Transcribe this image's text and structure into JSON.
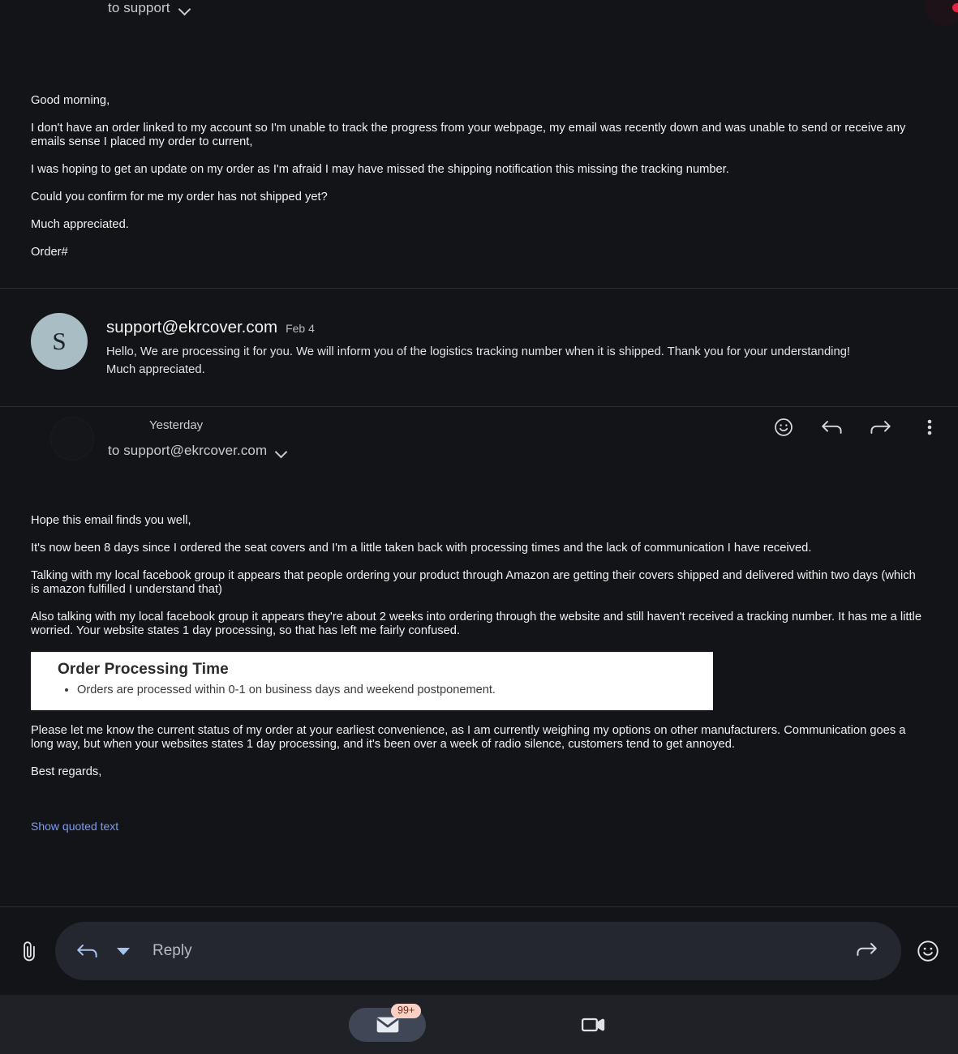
{
  "message1": {
    "to_label": "to support",
    "paragraphs": [
      "Good morning,",
      "I don't have an order linked to my account so I'm unable to track the progress from your webpage, my email was recently down and was unable to send or receive any emails sense I placed my order to current,",
      "I was hoping to get an update on my order as I'm afraid I may have missed the shipping notification this missing the tracking number.",
      "Could you confirm for me my order has not shipped yet?",
      "Much appreciated.",
      "Order#"
    ]
  },
  "message2": {
    "avatar_initial": "S",
    "sender": "support@ekrcover.com",
    "date": "Feb 4",
    "body": "Hello, We are processing it for you. We will inform you of the logistics tracking number when it is shipped. Thank you for your understanding! Much appreciated."
  },
  "message3": {
    "date": "Yesterday",
    "to_label": "to support@ekrcover.com",
    "actions": [
      {
        "name": "add-reaction-icon",
        "label": "Add reaction"
      },
      {
        "name": "reply-icon",
        "label": "Reply"
      },
      {
        "name": "forward-icon",
        "label": "Forward"
      },
      {
        "name": "more-options-icon",
        "label": "More options"
      }
    ],
    "paragraphs_before": [
      "Hope this email finds you well,",
      "It's now been 8 days since I ordered the seat covers and I'm a little taken back with processing times and the lack of communication I have received.",
      "Talking with my local facebook group it appears that people ordering your product through Amazon are getting their covers shipped and delivered within two days (which is amazon fulfilled I understand that)",
      "Also talking with my local facebook group it appears they're about 2 weeks into ordering through the website and still haven't received a tracking number. It has me a little worried. Your website states 1 day processing, so that has left me fairly confused."
    ],
    "order_card": {
      "title": "Order Processing Time",
      "bullet": "Orders are processed within 0-1 on business days and weekend postponement."
    },
    "paragraphs_after": [
      "Please let me know the current status of my order at your earliest convenience, as I am currently weighing my options on other manufacturers. Communication goes a long way, but when your websites states 1 day processing, and it's been over a week of radio silence, customers tend to get annoyed.",
      "Best regards,"
    ],
    "show_quoted_text": "Show quoted text"
  },
  "reply_bar": {
    "attach_label": "Attach file",
    "reply_placeholder": "Reply",
    "forward_label": "Forward",
    "emoji_label": "Insert emoji"
  },
  "bottom_nav": {
    "items": [
      {
        "name": "nav-mail",
        "label": "Mail",
        "badge": "99+",
        "selected": true
      },
      {
        "name": "nav-meet",
        "label": "Meet",
        "badge": "",
        "selected": false
      }
    ]
  },
  "colors": {
    "background": "#131418",
    "divider": "#2c2e33",
    "avatar": "#a9bdc5",
    "link": "#7a9df5",
    "reply_accent": "#a8c3ef",
    "nav_pill": "#3f4757",
    "badge_bg": "#fbd0c4",
    "badge_text": "#6e2b1b",
    "notification_dot": "#e62240"
  }
}
